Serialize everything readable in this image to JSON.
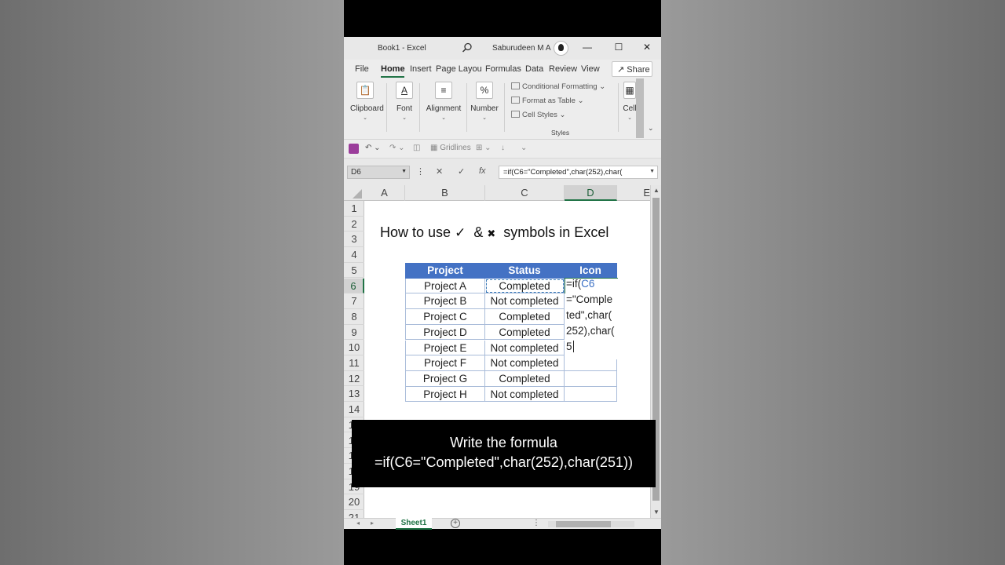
{
  "window": {
    "doc_title": "Book1  -  Excel",
    "user_name": "Saburudeen M A",
    "minimize": "—",
    "maximize": "☐",
    "close": "✕"
  },
  "ribbon_tabs": [
    {
      "label": "File"
    },
    {
      "label": "Home"
    },
    {
      "label": "Insert"
    },
    {
      "label": "Page Layou"
    },
    {
      "label": "Formulas"
    },
    {
      "label": "Data"
    },
    {
      "label": "Review"
    },
    {
      "label": "View"
    }
  ],
  "share_label": "Share",
  "ribbon_groups": {
    "clipboard": "Clipboard",
    "font": "Font",
    "alignment": "Alignment",
    "number": "Number",
    "number_symbol": "%",
    "cells": "Cell"
  },
  "styles": {
    "conditional_formatting": "Conditional Formatting",
    "format_as_table": "Format as Table",
    "cell_styles": "Cell Styles",
    "group_label": "Styles"
  },
  "qat": {
    "gridlines": "Gridlines"
  },
  "name_box": "D6",
  "formula_text": "=if(C6=\"Completed\",char(252),char(",
  "columns": [
    "A",
    "B",
    "C",
    "D",
    "E"
  ],
  "selected_column": "D",
  "rows": [
    "1",
    "2",
    "3",
    "4",
    "5",
    "6",
    "7",
    "8",
    "9",
    "10",
    "11",
    "12",
    "13",
    "14",
    "15",
    "16",
    "17",
    "18",
    "19",
    "20",
    "21"
  ],
  "selected_row": "6",
  "sheet_title": {
    "before": "How to use",
    "check": "✓",
    "amp": "&",
    "cross": "✖",
    "after": "symbols in Excel"
  },
  "table": {
    "headers": [
      "Project",
      "Status",
      "Icon"
    ],
    "rows": [
      {
        "project": "Project A",
        "status": "Completed"
      },
      {
        "project": "Project B",
        "status": "Not completed"
      },
      {
        "project": "Project C",
        "status": "Completed"
      },
      {
        "project": "Project D",
        "status": "Completed"
      },
      {
        "project": "Project E",
        "status": "Not completed"
      },
      {
        "project": "Project F",
        "status": "Not completed"
      },
      {
        "project": "Project G",
        "status": "Completed"
      },
      {
        "project": "Project H",
        "status": "Not completed"
      }
    ]
  },
  "cell_edit": {
    "line1_prefix": "=if(",
    "line1_ref": "C6",
    "line2": "=\"Comple",
    "line3": "ted\",char(",
    "line4": "252),char(",
    "line5": "5"
  },
  "caption": {
    "line1": "Write the formula",
    "line2": "=if(C6=\"Completed\",char(252),char(251))"
  },
  "sheet_tab": "Sheet1",
  "colors": {
    "header_blue": "#4472c4",
    "excel_green": "#217346",
    "reference_blue": "#3a6fc4"
  }
}
